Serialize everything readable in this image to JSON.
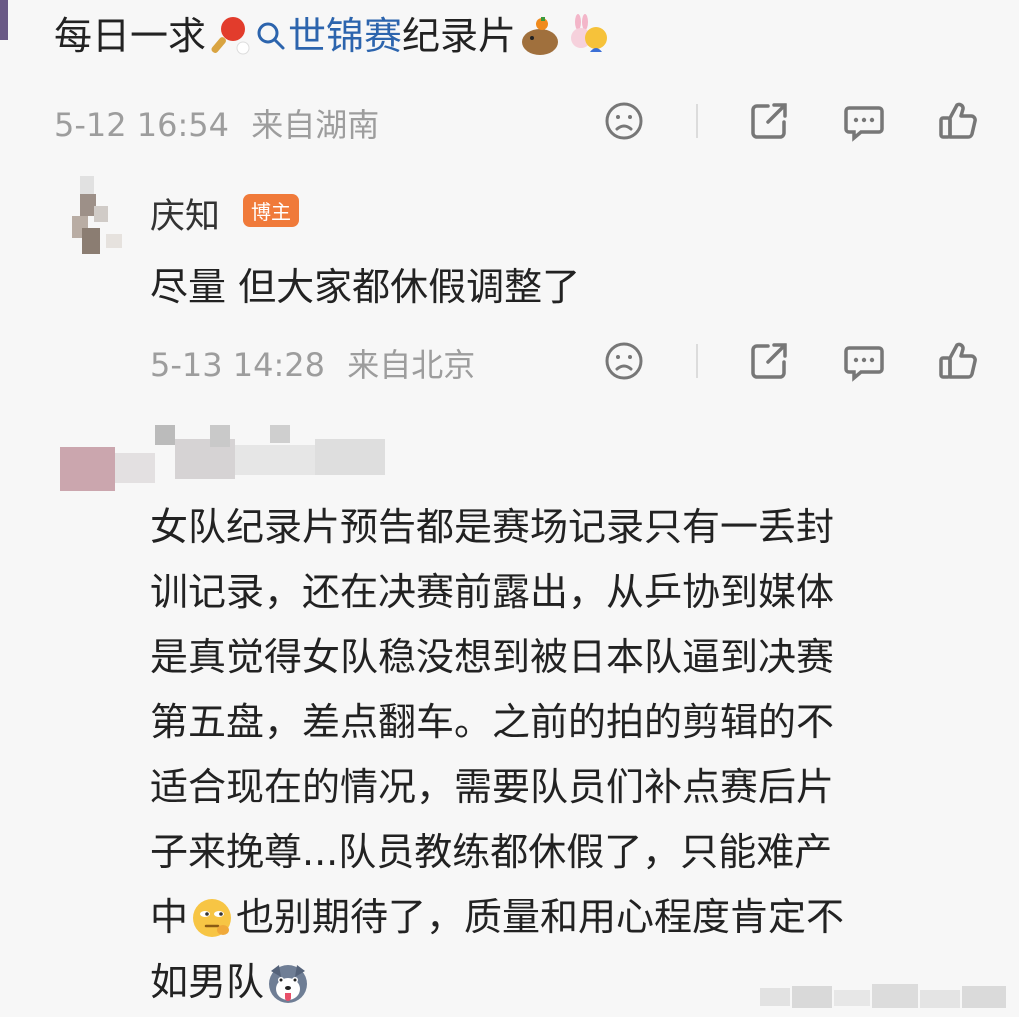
{
  "post": {
    "text_before_emoji": "每日一求",
    "ping_pong_emoji": "ping-pong-emoji",
    "search_icon": "search-icon",
    "link_text": "世锦赛",
    "text_after_link": "纪录片",
    "trailing_emojis": [
      "capybara-emoji",
      "bunny-hug-emoji"
    ],
    "timestamp": "5-12 16:54",
    "location": "来自湖南"
  },
  "reply": {
    "username": "庆知",
    "badge": "博主",
    "text": "尽量 但大家都休假调整了",
    "timestamp": "5-13 14:28",
    "location": "来自北京"
  },
  "comment": {
    "lines": [
      "女队纪录片预告都是赛场记录只有一丢封",
      "训记录，还在决赛前露出，从乒协到媒体",
      "是真觉得女队稳没想到被日本队逼到决赛",
      "第五盘，差点翻车。之前的拍的剪辑的不",
      "适合现在的情况，需要队员们补点赛后片",
      "子来挽尊...队员教练都休假了，只能难产"
    ],
    "line7_before": "中",
    "line7_after": "也别期待了，质量和用心程度肯定不",
    "line8": "如男队",
    "emojis": [
      "thinking-eyes-emoji",
      "husky-emoji"
    ]
  },
  "actions": [
    "dislike-icon",
    "share-icon",
    "comment-icon",
    "like-icon"
  ],
  "colors": {
    "link": "#2c64ad",
    "meta": "#9d9d9d",
    "badge": "#f07a3a",
    "text": "#222222",
    "background": "#f7f7f7"
  }
}
